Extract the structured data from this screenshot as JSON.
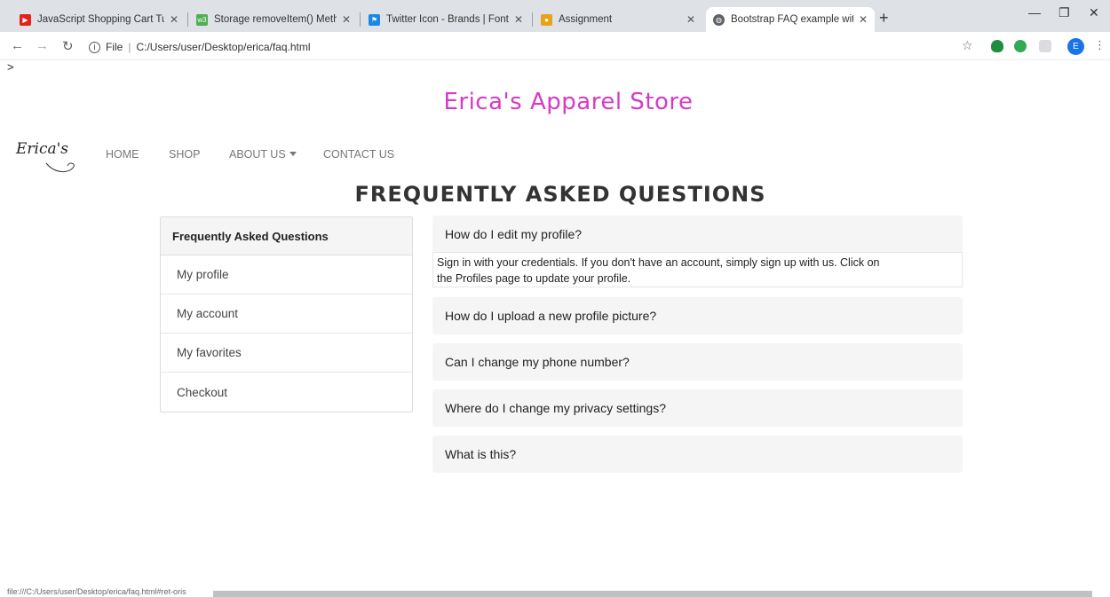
{
  "browser": {
    "tabs": [
      {
        "label": "JavaScript Shopping Cart Tutoria",
        "icon": "youtube-icon",
        "color": "#e62117"
      },
      {
        "label": "Storage removeItem() Method",
        "icon": "w3schools-icon",
        "color": "#4caf50"
      },
      {
        "label": "Twitter Icon - Brands | Font Awes",
        "icon": "fontawesome-icon",
        "color": "#1c88e5"
      },
      {
        "label": "Assignment",
        "icon": "assignment-icon",
        "color": "#e8a317"
      },
      {
        "label": "Bootstrap FAQ example with tab",
        "icon": "globe-icon",
        "color": "#5f6368"
      }
    ],
    "url_scheme": "File",
    "url": "C:/Users/user/Desktop/erica/faq.html",
    "avatar_letter": "E",
    "status_url": "file:///C:/Users/user/Desktop/erica/faq.html#ret-oris"
  },
  "page": {
    "stray_text": ">",
    "store_title": "Erica's Apparel Store",
    "logo_text": "Erica's",
    "nav": [
      {
        "label": "HOME"
      },
      {
        "label": "SHOP"
      },
      {
        "label": "ABOUT US"
      },
      {
        "label": "CONTACT US"
      }
    ],
    "faq_heading": "FREQUENTLY ASKED QUESTIONS",
    "sidebar": {
      "header": "Frequently Asked Questions",
      "items": [
        "My profile",
        "My account",
        "My favorites",
        "Checkout"
      ]
    },
    "faqs": [
      {
        "question": "How do I edit my profile?",
        "answer_line1": "Sign in with your credentials. If you don't have an account, simply sign up with us. Click on",
        "answer_line2": "the Profiles page to update your profile."
      },
      {
        "question": "How do I upload a new profile picture?"
      },
      {
        "question": "Can I change my phone number?"
      },
      {
        "question": "Where do I change my privacy settings?"
      },
      {
        "question": "What is this?"
      }
    ]
  },
  "colors": {
    "store_title": "#d63ac7",
    "card_bg": "#f5f5f5"
  }
}
